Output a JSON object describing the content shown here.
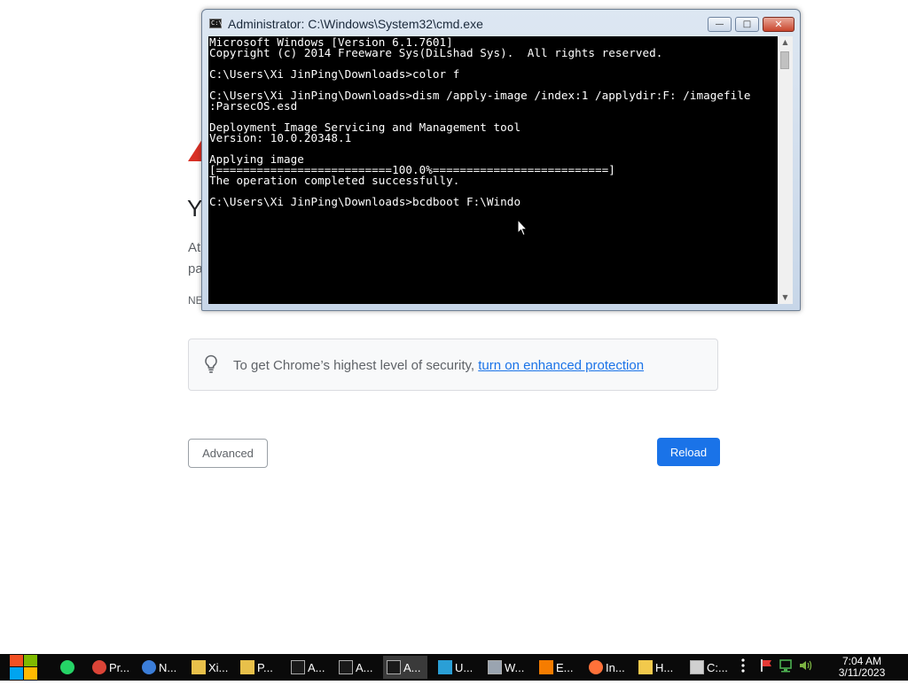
{
  "chrome_page": {
    "heading_partial": "Yo",
    "desc_line1_partial": "At",
    "desc_line2_partial": "pa",
    "error_code_partial": "NE",
    "security_text": "To get Chrome’s highest level of security, ",
    "security_link": "turn on enhanced protection",
    "advanced_label": "Advanced",
    "reload_label": "Reload",
    "accent_color": "#1a73e8",
    "warning_color": "#d93025"
  },
  "cmd": {
    "title": "Administrator: C:\\Windows\\System32\\cmd.exe",
    "icon_text": "C:\\",
    "lines": [
      "Microsoft Windows [Version 6.1.7601]",
      "Copyright (c) 2014 Freeware Sys(DiLshad Sys).  All rights reserved.",
      "",
      "C:\\Users\\Xi JinPing\\Downloads>color f",
      "",
      "C:\\Users\\Xi JinPing\\Downloads>dism /apply-image /index:1 /applydir:F: /imagefile",
      ":ParsecOS.esd",
      "",
      "Deployment Image Servicing and Management tool",
      "Version: 10.0.20348.1",
      "",
      "Applying image",
      "[==========================100.0%==========================]",
      "The operation completed successfully.",
      "",
      "C:\\Users\\Xi JinPing\\Downloads>bcdboot F:\\Windo"
    ],
    "minimize_glyph": "—",
    "maximize_glyph": "□",
    "close_glyph": "✕",
    "scroll_up_glyph": "▲",
    "scroll_down_glyph": "▼"
  },
  "taskbar": {
    "items": [
      {
        "label": "",
        "icon": "messaging-icon",
        "color": "#25d366"
      },
      {
        "label": "Pr...",
        "icon": "chrome-icon",
        "color": "#db4437"
      },
      {
        "label": "N...",
        "icon": "network-app-icon",
        "color": "#3b7dd8"
      },
      {
        "label": "Xi...",
        "icon": "folder-icon",
        "color": "#e8c04a"
      },
      {
        "label": "P...",
        "icon": "folder-icon",
        "color": "#e8c04a"
      },
      {
        "label": "A...",
        "icon": "cmd-icon",
        "color": "#1a1a1a"
      },
      {
        "label": "A...",
        "icon": "cmd-icon",
        "color": "#1a1a1a"
      },
      {
        "label": "A...",
        "icon": "cmd-icon",
        "color": "#1a1a1a"
      },
      {
        "label": "U...",
        "icon": "utility-icon",
        "color": "#2a9fd6"
      },
      {
        "label": "W...",
        "icon": "window-app-icon",
        "color": "#9aa4b0"
      },
      {
        "label": "E...",
        "icon": "search-icon",
        "color": "#f57c00"
      },
      {
        "label": "In...",
        "icon": "firefox-icon",
        "color": "#ff7139"
      },
      {
        "label": "H...",
        "icon": "help-icon",
        "color": "#f2c94c"
      },
      {
        "label": "C:...",
        "icon": "archive-icon",
        "color": "#d0d0d0"
      }
    ],
    "clock_time": "7:04 AM",
    "clock_date": "3/11/2023"
  }
}
